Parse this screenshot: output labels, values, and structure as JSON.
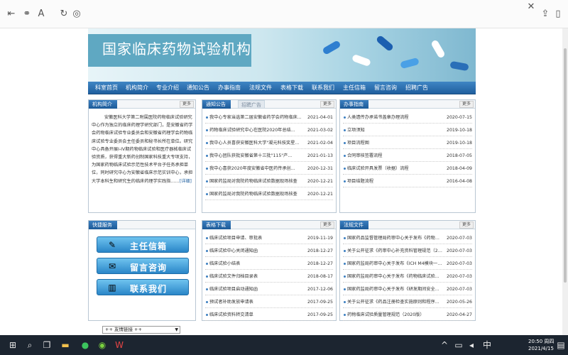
{
  "browser": {
    "icons": [
      "back-icon",
      "link-icon",
      "read-aloud-icon",
      "refresh-icon",
      "compass-icon",
      "close-icon",
      "share-icon",
      "reading-list-icon"
    ]
  },
  "site": {
    "banner_title": "国家临床药物试验机构",
    "nav": [
      "科室首页",
      "机构简介",
      "专业介绍",
      "通知公告",
      "办事指南",
      "法规文件",
      "表格下载",
      "联系我们",
      "主任信箱",
      "留言咨询",
      "招聘广告"
    ]
  },
  "intro": {
    "head": "机构简介",
    "more": "更多",
    "text": "安徽医科大学第二附属医院药物临床试验研究中心作为独立的临床药理学研究部门，是安徽省药学会药物临床试验专业委员会和安徽省药理学会药物临床试验专业委员会主任委员和秘书长所在单位。研究中心具备开展I-IV期药物临床试验和医疗器械临床试验资质，获得重大新药创制国家科技重大专项支持，为国家药物临床试验示范性技术平台子任务承担单位，同时研究中心为安徽省临床示范实训中心，承担大学本科生和研究生的临床药理学实践指……",
    "detail": "[详细]"
  },
  "notice": {
    "head": "通知公告",
    "tab2": "招聘广告",
    "more": "更多",
    "rows": [
      {
        "title": "我中心专家当选第二届安徽省药学会药物临床...",
        "date": "2021-04-01"
      },
      {
        "title": "药物临床试验研究中心在医院2020年总结...",
        "date": "2021-03-02"
      },
      {
        "title": "我中心人员喜获安徽医科大学\"凝元科技奖星...",
        "date": "2021-02-04"
      },
      {
        "title": "我中心团队获批安徽省第十三批\"115\"产...",
        "date": "2021-01-13"
      },
      {
        "title": "我中心喜获2020年度安徽省中医药传承创...",
        "date": "2020-12-31"
      },
      {
        "title": "国家药监局对我院药物临床试验数据现场核查",
        "date": "2020-12-21"
      },
      {
        "title": "国家药监局对我院药物临床试验数据现场核查",
        "date": "2020-12-21"
      }
    ]
  },
  "guide": {
    "head": "办事指南",
    "more": "更多",
    "rows": [
      {
        "title": "人类遗传办承诺书盖章办理流程",
        "date": "2020-07-15"
      },
      {
        "title": "立项须知",
        "date": "2019-10-18"
      },
      {
        "title": "项目流程图",
        "date": "2019-10-18"
      },
      {
        "title": "合同审核签署流程",
        "date": "2018-07-05"
      },
      {
        "title": "临床试验开具发票（收据）流程",
        "date": "2018-04-09"
      },
      {
        "title": "项目结题流程",
        "date": "2016-04-08"
      }
    ]
  },
  "quick": {
    "head": "快捷服务",
    "buttons": [
      {
        "label": "主任信箱",
        "icon": "mailbox-icon"
      },
      {
        "label": "留言咨询",
        "icon": "message-icon"
      },
      {
        "label": "联系我们",
        "icon": "contact-books-icon"
      }
    ]
  },
  "forms": {
    "head": "表格下载",
    "more": "更多",
    "rows": [
      {
        "title": "临床试验项目申请、审批表",
        "date": "2019-11-19"
      },
      {
        "title": "临床试验中心关闭通知函",
        "date": "2018-12-27"
      },
      {
        "title": "临床试验小结表",
        "date": "2018-12-27"
      },
      {
        "title": "临床试验文件归档目录表",
        "date": "2018-08-17"
      },
      {
        "title": "临床试验项目启动通知函",
        "date": "2017-12-06"
      },
      {
        "title": "预试者补助发放申请表",
        "date": "2017-09-25"
      },
      {
        "title": "临床试验资料转交清单",
        "date": "2017-09-25"
      }
    ]
  },
  "laws": {
    "head": "法规文件",
    "more": "更多",
    "rows": [
      {
        "title": "国家药品监督管理局药审中心关于发布《药物临床试验...",
        "date": "2020-07-03"
      },
      {
        "title": "关于公开征求《药审中心补充资料管理规范（20...",
        "date": "2020-07-03"
      },
      {
        "title": "国家药监局药审中心关于发布《ICH M4模块一行...",
        "date": "2020-07-03"
      },
      {
        "title": "国家药监局药审中心关于发布《药物临床试验...",
        "date": "2020-07-03"
      },
      {
        "title": "国家药监局药审中心关于发布《研发期间安全...",
        "date": "2020-07-03"
      },
      {
        "title": "关于公开征求《药品注册检查实施原则和程序...",
        "date": "2020-05-26"
      },
      {
        "title": "药物临床试验质量管理规范（2020版）",
        "date": "2020-04-27"
      }
    ]
  },
  "links": {
    "select_value": "++ 友情链接 ++"
  },
  "taskbar": {
    "time": "20:50 周四",
    "date": "2021/4/15",
    "ime": "中",
    "icons": [
      "windows-start-icon",
      "search-icon",
      "task-view-icon",
      "file-explorer-icon",
      "wechat-icon",
      "app-green-icon",
      "wps-icon",
      "chevron-up-icon",
      "network-icon",
      "volume-icon",
      "notification-icon"
    ]
  }
}
